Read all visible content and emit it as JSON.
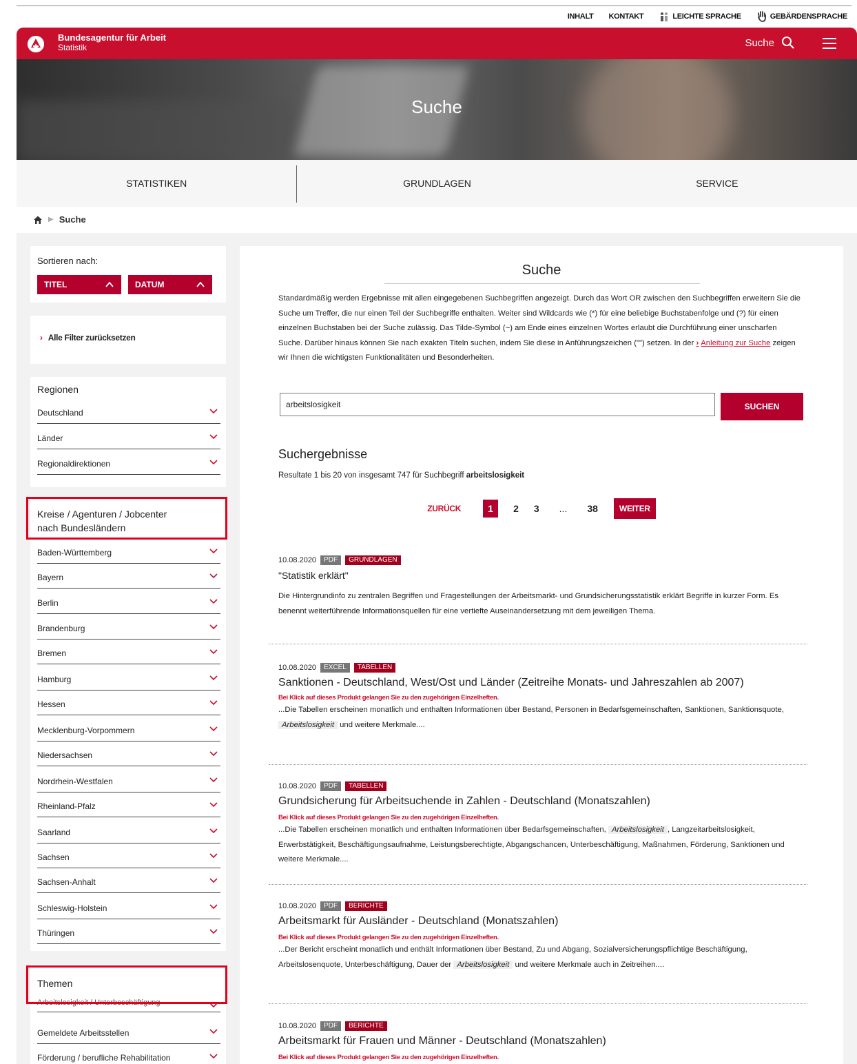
{
  "utility": {
    "inhalt": "INHALT",
    "kontakt": "KONTAKT",
    "leichte": "LEICHTE SPRACHE",
    "gebaerden": "GEBÄRDENSPRACHE"
  },
  "header": {
    "brand_line1": "Bundesagentur für Arbeit",
    "brand_line2": "Statistik",
    "search_label": "Suche"
  },
  "hero": {
    "title": "Suche"
  },
  "nav": {
    "items": [
      "STATISTIKEN",
      "GRUNDLAGEN",
      "SERVICE"
    ]
  },
  "breadcrumb": {
    "current": "Suche"
  },
  "sort": {
    "label": "Sortieren nach:",
    "title_btn": "TITEL",
    "date_btn": "DATUM"
  },
  "reset": {
    "label": "Alle Filter zurücksetzen"
  },
  "regions": {
    "heading": "Regionen",
    "items": [
      "Deutschland",
      "Länder",
      "Regionaldirektionen"
    ]
  },
  "kreise": {
    "heading": "Kreise / Agenturen / Jobcenter nach Bundesländern",
    "items": [
      "Baden-Württemberg",
      "Bayern",
      "Berlin",
      "Brandenburg",
      "Bremen",
      "Hamburg",
      "Hessen",
      "Mecklenburg-Vorpommern",
      "Niedersachsen",
      "Nordrhein-Westfalen",
      "Rheinland-Pfalz",
      "Saarland",
      "Sachsen",
      "Sachsen-Anhalt",
      "Schleswig-Holstein",
      "Thüringen"
    ]
  },
  "themen": {
    "heading": "Themen",
    "items": [
      "Arbeitslosigkeit / Unterbeschäftigung",
      "Gemeldete Arbeitsstellen",
      "Förderung / berufliche Rehabilitation"
    ]
  },
  "main": {
    "title": "Suche",
    "intro_text": "Standardmäßig werden Ergebnisse mit allen eingegebenen Suchbegriffen angezeigt. Durch das Wort OR zwischen den Suchbegriffen erweitern Sie die Suche um Treffer, die nur einen Teil der Suchbegriffe enthalten. Weiter sind Wildcards wie (*) für eine beliebige Buchstabenfolge und (?) für einen einzelnen Buchstaben bei der Suche zulässig. Das Tilde-Symbol (~) am Ende eines einzelnen Wortes erlaubt die Durchführung einer unscharfen Suche. Darüber hinaus können Sie nach exakten Titeln suchen, indem Sie diese in Anführungszeichen (\"\") setzen. In der",
    "intro_link": "Anleitung zur Suche",
    "intro_end": "zeigen wir Ihnen die wichtigsten Funktionalitäten und Besonderheiten.",
    "search_value": "arbeitslosigkeit",
    "search_button": "SUCHEN",
    "results_heading": "Suchergebnisse",
    "results_count_prefix": "Resultate 1 bis 20 von insgesamt 747 für Suchbegriff",
    "results_term": "arbeitslosigkeit"
  },
  "pager": {
    "prev": "ZURÜCK",
    "current": "1",
    "p2": "2",
    "p3": "3",
    "dots": "...",
    "last": "38",
    "next": "WEITER"
  },
  "results": [
    {
      "date": "10.08.2020",
      "format": "PDF",
      "category": "GRUNDLAGEN",
      "title": "\"Statistik erklärt\"",
      "desc": "Die Hintergrundinfo zu zentralen Begriffen und Fragestellungen der Arbeitsmarkt- und Grundsicherungsstatistik erklärt Begriffe in kurzer Form. Es benennt weiterführende Informationsquellen für eine vertiefte Auseinandersetzung mit dem jeweiligen Thema."
    },
    {
      "date": "10.08.2020",
      "format": "EXCEL",
      "category": "TABELLEN",
      "title": "Sanktionen - Deutschland, West/Ost und Länder (Zeitreihe Monats- und Jahreszahlen ab 2007)",
      "notice": "Bei Klick auf dieses Produkt gelangen Sie zu den zugehörigen Einzelheften.",
      "desc_pre": "...Die Tabellen erscheinen monatlich und enthalten Informationen über Bestand, Personen in Bedarfsgemeinschaften, Sanktionen, Sanktionsquote,",
      "desc_em": "Arbeitslosigkeit",
      "desc_post": "und weitere Merkmale...."
    },
    {
      "date": "10.08.2020",
      "format": "PDF",
      "category": "TABELLEN",
      "title": "Grundsicherung für Arbeitsuchende in Zahlen - Deutschland (Monatszahlen)",
      "notice": "Bei Klick auf dieses Produkt gelangen Sie zu den zugehörigen Einzelheften.",
      "desc_pre": "...Die Tabellen erscheinen monatlich und enthalten Informationen über Bedarfsgemeinschaften,",
      "desc_em": "Arbeitslosigkeit",
      "desc_post": ", Langzeitarbeitslosigkeit, Erwerbstätigkeit, Beschäftigungsaufnahme, Leistungsberechtigte, Abgangschancen, Unterbeschäftigung, Maßnahmen, Förderung, Sanktionen und weitere Merkmale...."
    },
    {
      "date": "10.08.2020",
      "format": "PDF",
      "category": "BERICHTE",
      "title": "Arbeitsmarkt für Ausländer - Deutschland (Monatszahlen)",
      "notice": "Bei Klick auf dieses Produkt gelangen Sie zu den zugehörigen Einzelheften.",
      "desc_pre": "...Der Bericht erscheint monatlich und enthält Informationen über Bestand, Zu und Abgang, Sozialversicherungspflichtige Beschäftigung, Arbeitslosenquote, Unterbeschäftigung, Dauer der",
      "desc_em": "Arbeitslosigkeit",
      "desc_post": "und weitere Merkmale auch in Zeitreihen...."
    },
    {
      "date": "10.08.2020",
      "format": "PDF",
      "category": "BERICHTE",
      "title": "Arbeitsmarkt für Frauen und Männer - Deutschland (Monatszahlen)",
      "notice": "Bei Klick auf dieses Produkt gelangen Sie zu den zugehörigen Einzelheften."
    }
  ],
  "colors": {
    "brand_red": "#c8102e",
    "button_red": "#b3002d",
    "highlight": "#e4001b"
  },
  "icons": {
    "search": "search-icon",
    "menu": "menu-icon",
    "home": "home-icon",
    "chevron": "chevron-down-icon"
  }
}
